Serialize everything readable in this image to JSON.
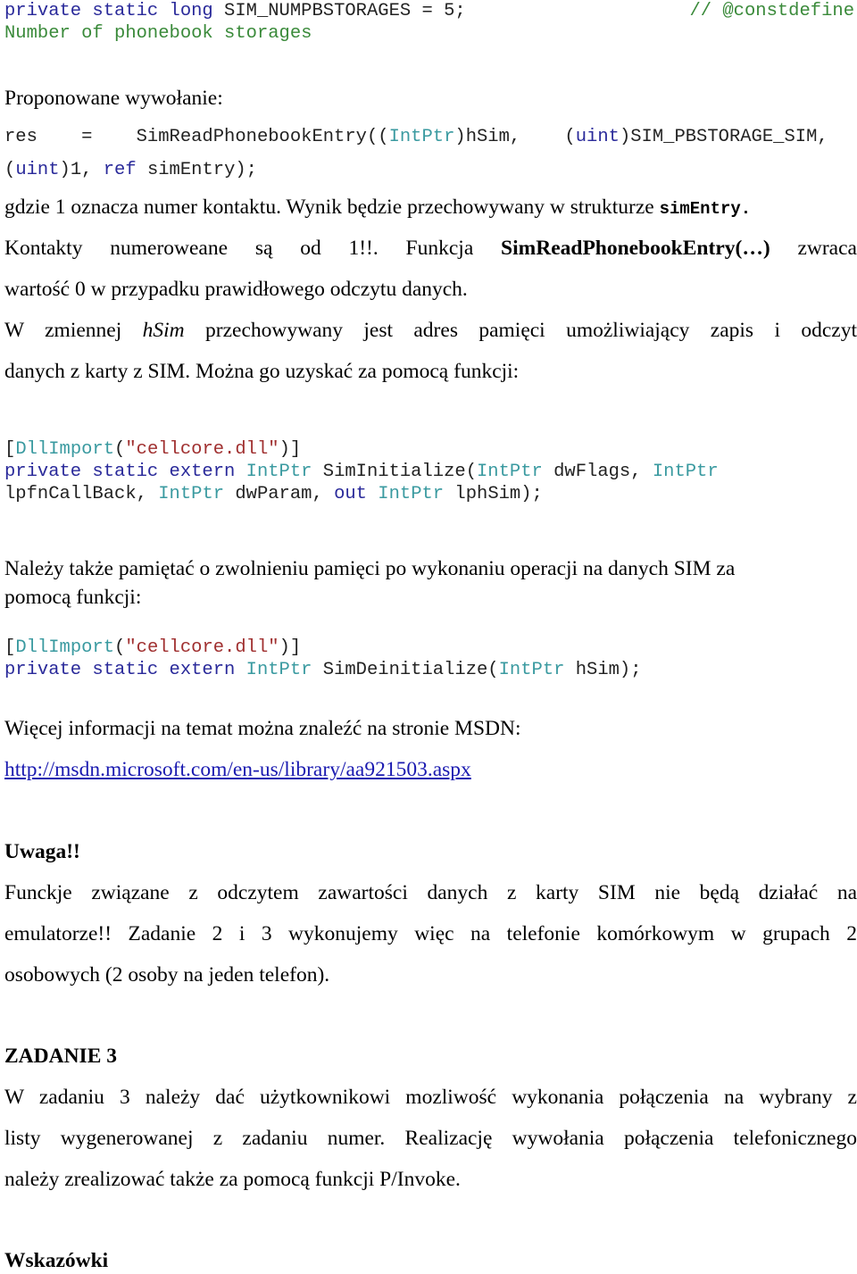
{
  "code1": {
    "line1": {
      "kw": "private static long",
      "rest": " SIM_NUMPBSTORAGES = 5;",
      "comment": "// @constdefine"
    },
    "line2": {
      "comment": "Number of phonebook storages"
    }
  },
  "proposed_call_label": "Proponowane wywołanie:",
  "call": {
    "l1_a": "res    =    SimReadPhonebookEntry((",
    "l1_type": "IntPtr",
    "l1_b": ")hSim,    (",
    "l1_kw": "uint",
    "l1_c": ")SIM_PBSTORAGE_SIM,",
    "l2_a": "(",
    "l2_kw": "uint",
    "l2_b": ")1, ",
    "l2_kw2": "ref",
    "l2_c": " simEntry);"
  },
  "para1": {
    "l1_text": "gdzie 1 oznacza numer kontaktu. Wynik będzie przechowywany w strukturze ",
    "l1_code": "simEntry",
    "l1_end": ".",
    "l2_a": "Kontakty numeroweane są od 1!!. Funkcja ",
    "l2_bold": "SimReadPhonebookEntry(…)",
    "l2_b": " zwraca",
    "l3": "wartość 0 w przypadku prawidłowego odczytu danych."
  },
  "para2": {
    "l1_a": "W zmiennej ",
    "l1_it": "hSim",
    "l1_b": " przechowywany jest adres pamięci umożliwiający zapis i odczyt",
    "l2": "danych z karty z SIM. Można go uzyskać za pomocą funkcji:"
  },
  "code2": {
    "attr_open": "[",
    "attr_name": "DllImport",
    "paren_open": "(",
    "dll": "\"cellcore.dll\"",
    "attr_close": ")]",
    "l2_kw": "private static extern",
    "type": "IntPtr",
    "fn": " SimInitialize(",
    "p1": " dwFlags, ",
    "l3_a": "lpfnCallBack, ",
    "p3": " dwParam, ",
    "out": "out",
    "p4": " lphSim);"
  },
  "para3": {
    "l1": "Należy także pamiętać o zwolnieniu pamięci po wykonaniu operacji na danych SIM za",
    "l2": "pomocą funkcji:"
  },
  "code3": {
    "fn": " SimDeinitialize(",
    "p1": " hSim);"
  },
  "more_info": "Więcej informacji na temat można znaleźć na stronie MSDN:",
  "msdn_link": "http://msdn.microsoft.com/en-us/library/aa921503.aspx",
  "warning": {
    "title": "Uwaga!!",
    "l1": "Funckje związane z odczytem zawartości danych z karty SIM nie będą działać na",
    "l2": "emulatorze!! Zadanie 2 i 3 wykonujemy więc na telefonie komórkowym w grupach 2",
    "l3": "osobowych (2 osoby na jeden telefon)."
  },
  "task3": {
    "title": "ZADANIE 3",
    "l1": "W zadaniu 3 należy dać użytkownikowi mozliwość wykonania połączenia na wybrany z",
    "l2": "listy wygenerowanej z zadaniu numer. Realizację wywołania połączenia telefonicznego",
    "l3": "należy zrealizować także za pomocą funkcji P/Invoke."
  },
  "hints_title": "Wskazówki"
}
